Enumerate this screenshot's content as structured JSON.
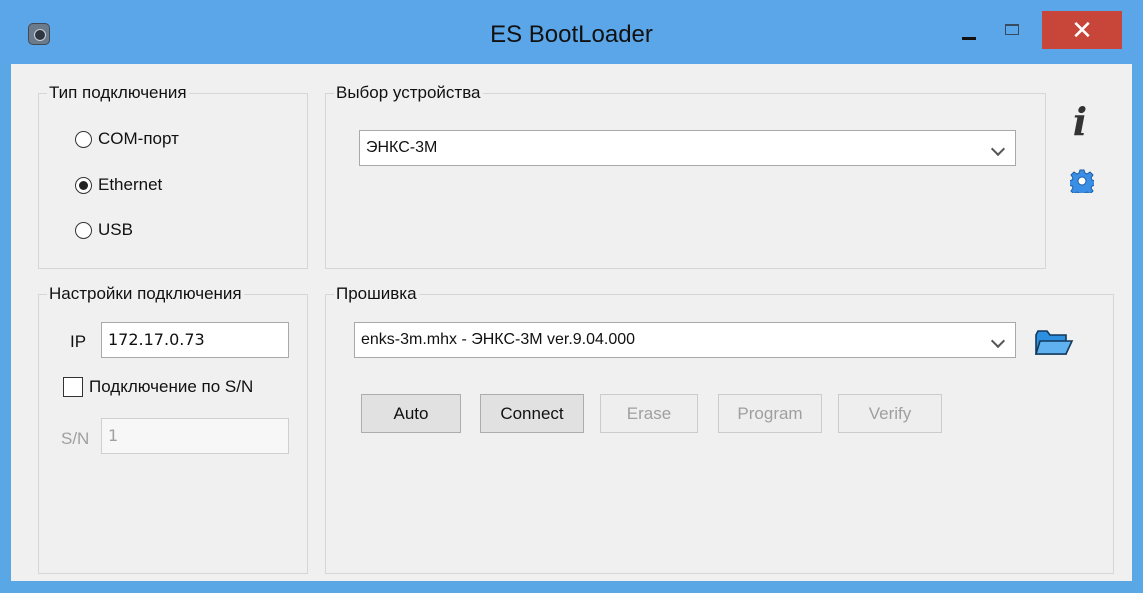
{
  "window": {
    "title": "ES BootLoader",
    "close_symbol": "✕"
  },
  "connection_type": {
    "label": "Тип подключения",
    "options": [
      {
        "label": "COM-порт",
        "selected": false
      },
      {
        "label": "Ethernet",
        "selected": true
      },
      {
        "label": "USB",
        "selected": false
      }
    ]
  },
  "device_selection": {
    "label": "Выбор устройства",
    "selected": "ЭНКС-3М"
  },
  "connection_settings": {
    "label": "Настройки подключения",
    "ip_label": "IP",
    "ip_value": "172.17.0.73",
    "sn_checkbox_label": "Подключение по S/N",
    "sn_checked": false,
    "sn_label": "S/N",
    "sn_value": "1"
  },
  "firmware": {
    "label": "Прошивка",
    "selected": "enks-3m.mhx  - ЭНКС-3М ver.9.04.000",
    "buttons": [
      {
        "label": "Auto",
        "enabled": true
      },
      {
        "label": "Connect",
        "enabled": true
      },
      {
        "label": "Erase",
        "enabled": false
      },
      {
        "label": "Program",
        "enabled": false
      },
      {
        "label": "Verify",
        "enabled": false
      }
    ]
  },
  "icons": {
    "app": "app-icon",
    "info": "info-icon",
    "settings": "gear-icon",
    "open_file": "folder-open-icon"
  },
  "colors": {
    "titlebar": "#5ba6e8",
    "close_button": "#c8453a",
    "gear": "#3a8ee6",
    "folder": "#2d8fe0"
  }
}
